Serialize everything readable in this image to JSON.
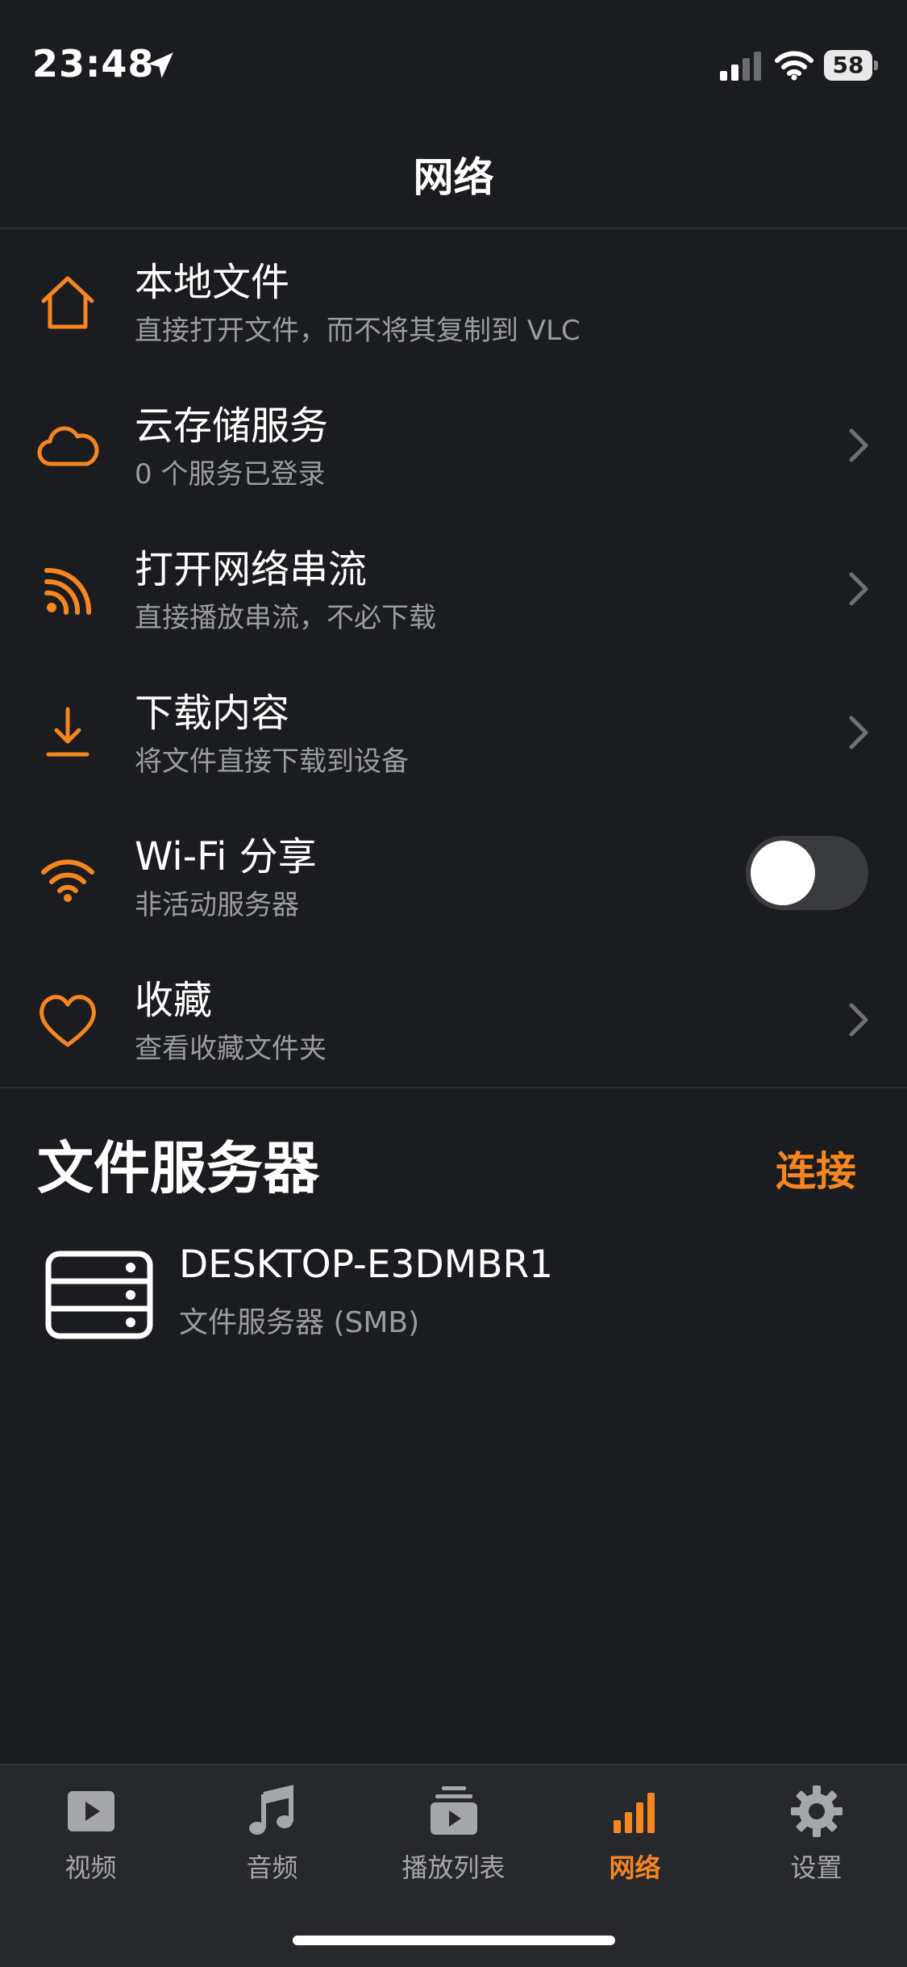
{
  "status_bar": {
    "time": "23:48",
    "battery": "58"
  },
  "nav": {
    "title": "网络"
  },
  "rows": [
    {
      "title": "本地文件",
      "subtitle": "直接打开文件，而不将其复制到 VLC",
      "icon": "house-icon"
    },
    {
      "title": "云存储服务",
      "subtitle": "0 个服务已登录",
      "icon": "cloud-icon"
    },
    {
      "title": "打开网络串流",
      "subtitle": "直接播放串流，不必下载",
      "icon": "rss-icon"
    },
    {
      "title": "下载内容",
      "subtitle": "将文件直接下载到设备",
      "icon": "download-icon"
    },
    {
      "title": "Wi-Fi 分享",
      "subtitle": "非活动服务器",
      "icon": "wifi-share-icon",
      "toggle_on": false
    },
    {
      "title": "收藏",
      "subtitle": "查看收藏文件夹",
      "icon": "heart-icon"
    }
  ],
  "file_servers": {
    "title": "文件服务器",
    "connect_label": "连接",
    "items": [
      {
        "name": "DESKTOP-E3DMBR1",
        "type": "文件服务器 (SMB)",
        "icon": "server-icon"
      }
    ]
  },
  "tabbar": {
    "tabs": [
      {
        "label": "视频",
        "icon": "video-icon"
      },
      {
        "label": "音频",
        "icon": "music-icon"
      },
      {
        "label": "播放列表",
        "icon": "playlist-icon"
      },
      {
        "label": "网络",
        "icon": "network-icon",
        "active": true
      },
      {
        "label": "设置",
        "icon": "gear-icon"
      }
    ]
  },
  "colors": {
    "accent": "#f6861f",
    "background": "#1b1c1f",
    "subtitle": "#9b9ca1"
  }
}
